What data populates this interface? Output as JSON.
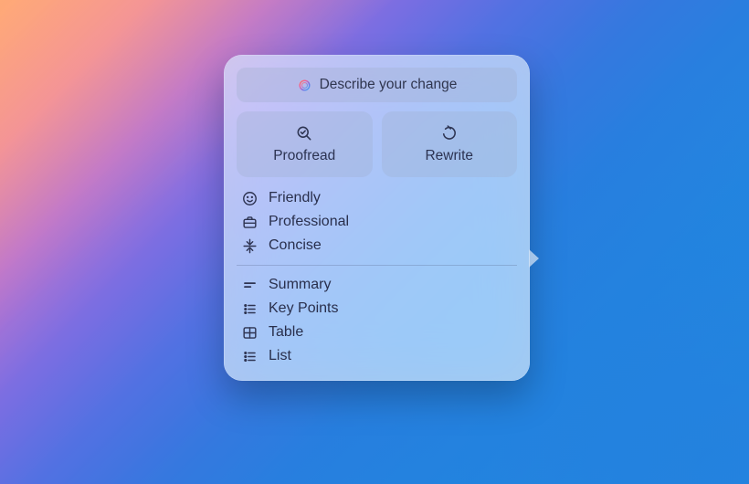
{
  "panel": {
    "input": {
      "placeholder": "Describe your change"
    },
    "actions": {
      "proofread": {
        "label": "Proofread"
      },
      "rewrite": {
        "label": "Rewrite"
      }
    },
    "tones": [
      {
        "label": "Friendly"
      },
      {
        "label": "Professional"
      },
      {
        "label": "Concise"
      }
    ],
    "formats": [
      {
        "label": "Summary"
      },
      {
        "label": "Key Points"
      },
      {
        "label": "Table"
      },
      {
        "label": "List"
      }
    ]
  }
}
